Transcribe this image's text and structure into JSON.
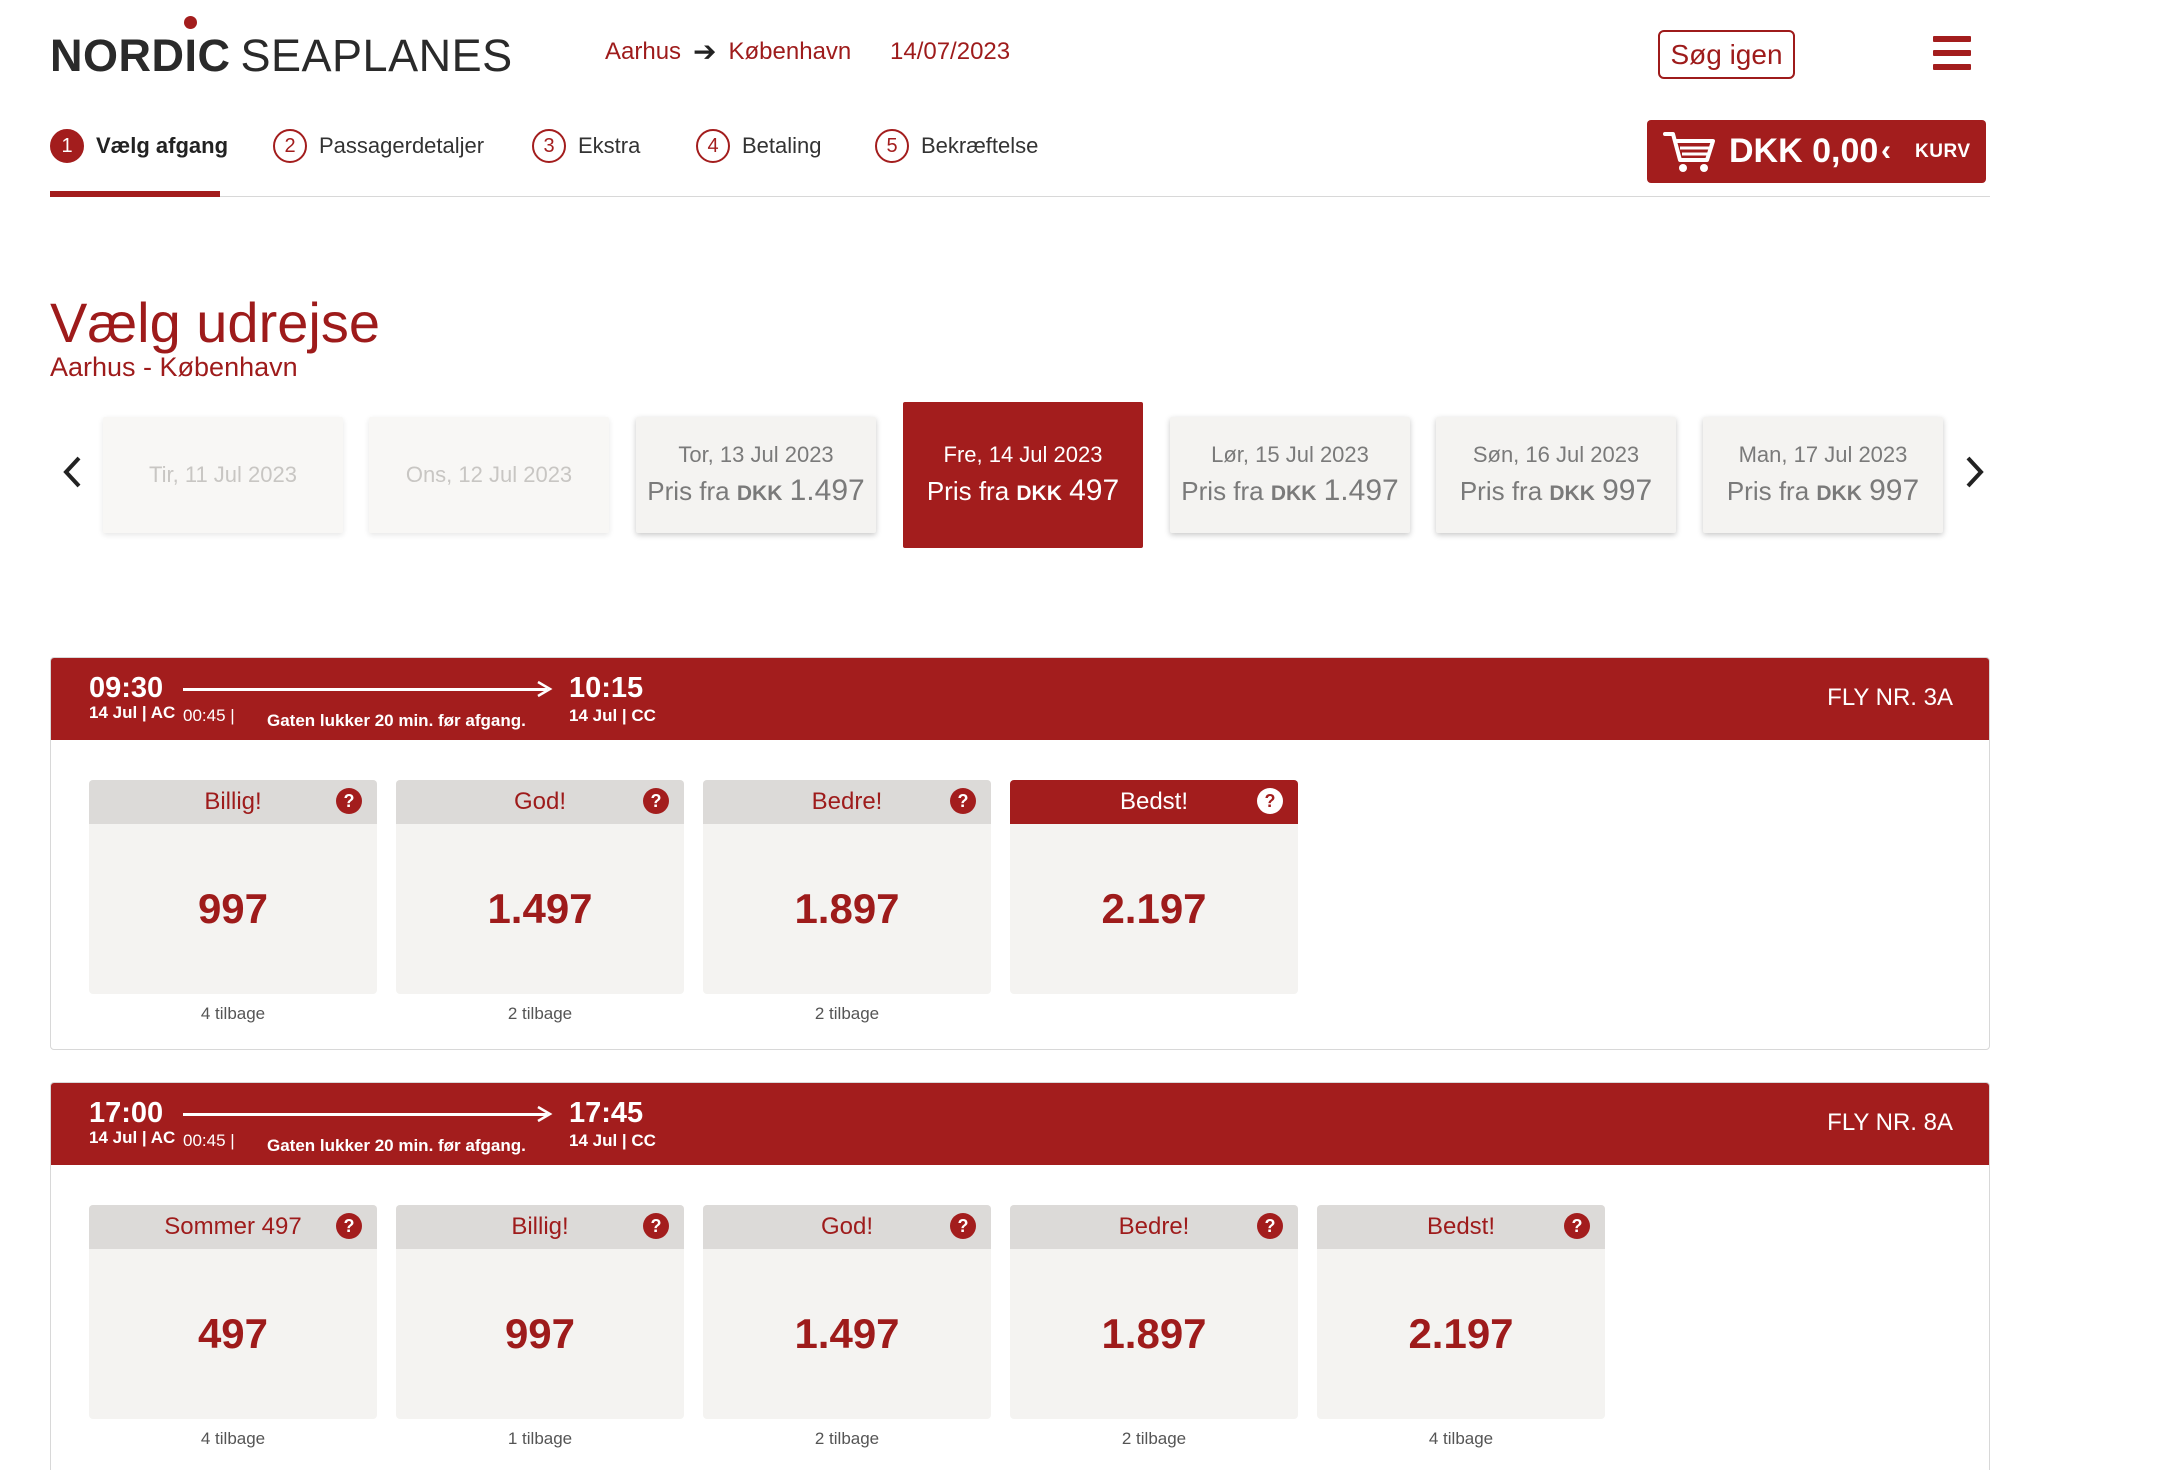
{
  "header": {
    "logo_part1": "NORDIC",
    "logo_part2": "SEAPLANES",
    "route_from": "Aarhus",
    "route_to": "København",
    "date": "14/07/2023",
    "search_again": "Søg igen"
  },
  "steps": [
    {
      "num": "1",
      "label": "Vælg afgang"
    },
    {
      "num": "2",
      "label": "Passagerdetaljer"
    },
    {
      "num": "3",
      "label": "Ekstra"
    },
    {
      "num": "4",
      "label": "Betaling"
    },
    {
      "num": "5",
      "label": "Bekræftelse"
    }
  ],
  "cart": {
    "amount": "DKK 0,00",
    "label": "KURV"
  },
  "page": {
    "title": "Vælg udrejse",
    "subtitle": "Aarhus - København"
  },
  "dates": [
    {
      "label": "Tir, 11 Jul 2023",
      "disabled": true
    },
    {
      "label": "Ons, 12 Jul 2023",
      "disabled": true
    },
    {
      "label": "Tor, 13 Jul 2023",
      "prefix": "Pris fra",
      "currency": "DKK",
      "price": "1.497"
    },
    {
      "label": "Fre, 14 Jul 2023",
      "prefix": "Pris fra",
      "currency": "DKK",
      "price": "497",
      "selected": true
    },
    {
      "label": "Lør, 15 Jul 2023",
      "prefix": "Pris fra",
      "currency": "DKK",
      "price": "1.497"
    },
    {
      "label": "Søn, 16 Jul 2023",
      "prefix": "Pris fra",
      "currency": "DKK",
      "price": "997"
    },
    {
      "label": "Man, 17 Jul 2023",
      "prefix": "Pris fra",
      "currency": "DKK",
      "price": "997"
    }
  ],
  "flights": [
    {
      "dep_time": "09:30",
      "dep_sub": "14 Jul | AC",
      "duration": "00:45 |",
      "gate_note": "Gaten lukker 20 min. før afgang.",
      "arr_time": "10:15",
      "arr_sub": "14 Jul | CC",
      "flight_no": "FLY NR. 3A",
      "fares": [
        {
          "name": "Billig!",
          "price": "997",
          "left": "4 tilbage"
        },
        {
          "name": "God!",
          "price": "1.497",
          "left": "2 tilbage"
        },
        {
          "name": "Bedre!",
          "price": "1.897",
          "left": "2 tilbage"
        },
        {
          "name": "Bedst!",
          "price": "2.197",
          "left": "",
          "best": true
        }
      ]
    },
    {
      "dep_time": "17:00",
      "dep_sub": "14 Jul | AC",
      "duration": "00:45 |",
      "gate_note": "Gaten lukker 20 min. før afgang.",
      "arr_time": "17:45",
      "arr_sub": "14 Jul | CC",
      "flight_no": "FLY NR. 8A",
      "fares": [
        {
          "name": "Sommer 497",
          "price": "497",
          "left": "4 tilbage"
        },
        {
          "name": "Billig!",
          "price": "997",
          "left": "1 tilbage"
        },
        {
          "name": "God!",
          "price": "1.497",
          "left": "2 tilbage"
        },
        {
          "name": "Bedre!",
          "price": "1.897",
          "left": "2 tilbage"
        },
        {
          "name": "Bedst!",
          "price": "2.197",
          "left": "4 tilbage"
        }
      ]
    }
  ],
  "help_glyph": "?",
  "colors": {
    "brand": "#a31d1d",
    "card_bg": "#f4f3f1",
    "card_head": "#dcdad8"
  }
}
